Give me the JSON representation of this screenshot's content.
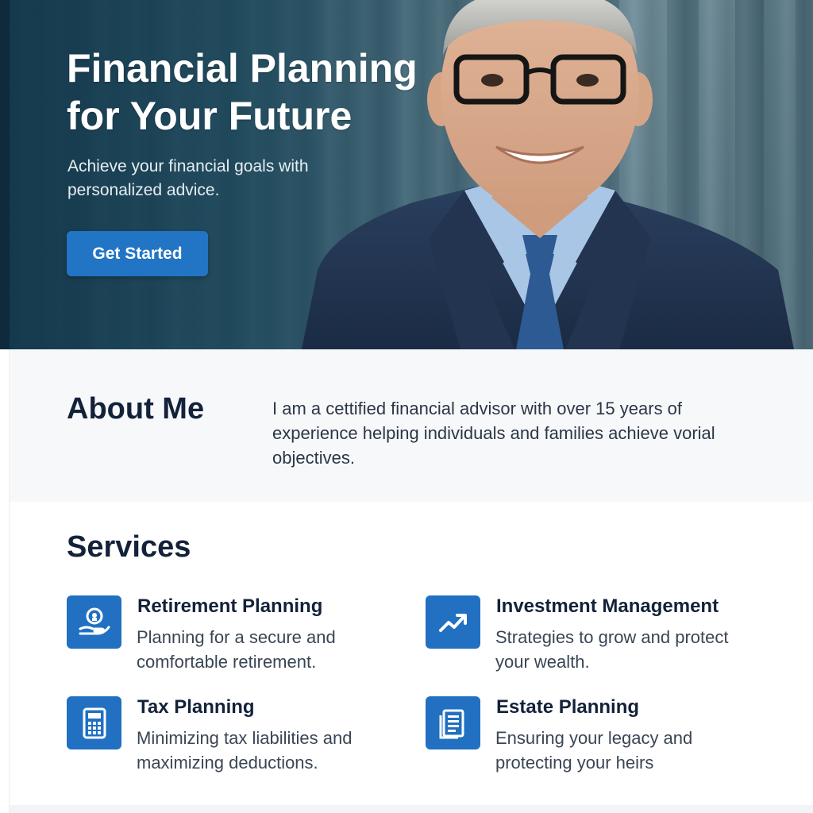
{
  "hero": {
    "title": "Financial Planning for Your Future",
    "subtitle": "Achieve your financial goals with personalized advice.",
    "cta_label": "Get Started",
    "cta_color": "#2274c4"
  },
  "about": {
    "title": "About Me",
    "text": "I am a cettified financial advisor with over 15 years of experience helping individuals and families achieve vorial objectives."
  },
  "services": {
    "title": "Services",
    "items": [
      {
        "icon": "retirement-icon",
        "name": "Retirement Planning",
        "description": "Planning for a secure and comfortable retirement."
      },
      {
        "icon": "trend-up-icon",
        "name": "Investment Management",
        "description": "Strategies to grow and protect your wealth."
      },
      {
        "icon": "calculator-icon",
        "name": "Tax Planning",
        "description": "Minimizing tax liabilities and maximizing deductions."
      },
      {
        "icon": "document-icon",
        "name": "Estate Planning",
        "description": "Ensuring your legacy and protecting your heirs"
      }
    ]
  },
  "colors": {
    "accent": "#2170c2",
    "heading": "#13223a",
    "hero_background": "#1e4a5e"
  }
}
